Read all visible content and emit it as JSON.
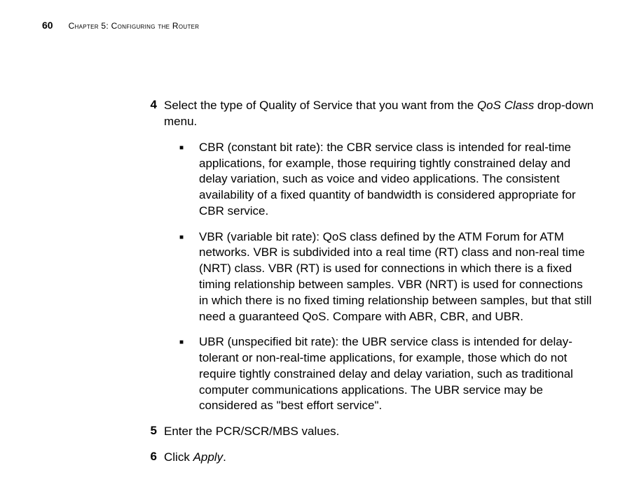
{
  "header": {
    "page_number": "60",
    "chapter_title": "Chapter 5: Configuring the Router"
  },
  "steps": {
    "step4": {
      "number": "4",
      "text_before_italic": "Select the type of Quality of Service that you want from the ",
      "italic_text": "QoS Class",
      "text_after_italic": " drop-down menu."
    },
    "step5": {
      "number": "5",
      "text": "Enter the PCR/SCR/MBS values."
    },
    "step6": {
      "number": "6",
      "text_before_italic": "Click ",
      "italic_text": "Apply",
      "text_after_italic": "."
    }
  },
  "bullets": {
    "cbr": "CBR (constant bit rate): the CBR service class is intended for real-time applications, for example, those requiring tightly constrained delay and delay variation, such as voice and video applications. The consistent availability of a fixed quantity of bandwidth is considered appropriate for CBR service.",
    "vbr": "VBR (variable bit rate): QoS class defined by the ATM Forum for ATM networks. VBR is subdivided into a real time (RT) class and non-real time (NRT) class. VBR (RT) is used for connections in which there is a fixed timing relationship between samples. VBR (NRT) is used for connections in which there is no fixed timing relationship between samples, but that still need a guaranteed QoS. Compare with ABR, CBR, and UBR.",
    "ubr": "UBR (unspecified bit rate): the UBR service class is intended for delay-tolerant or non-real-time applications, for example, those which do not require tightly constrained delay and delay variation, such as traditional computer communications applications. The UBR service may be considered as \"best effort service\"."
  }
}
